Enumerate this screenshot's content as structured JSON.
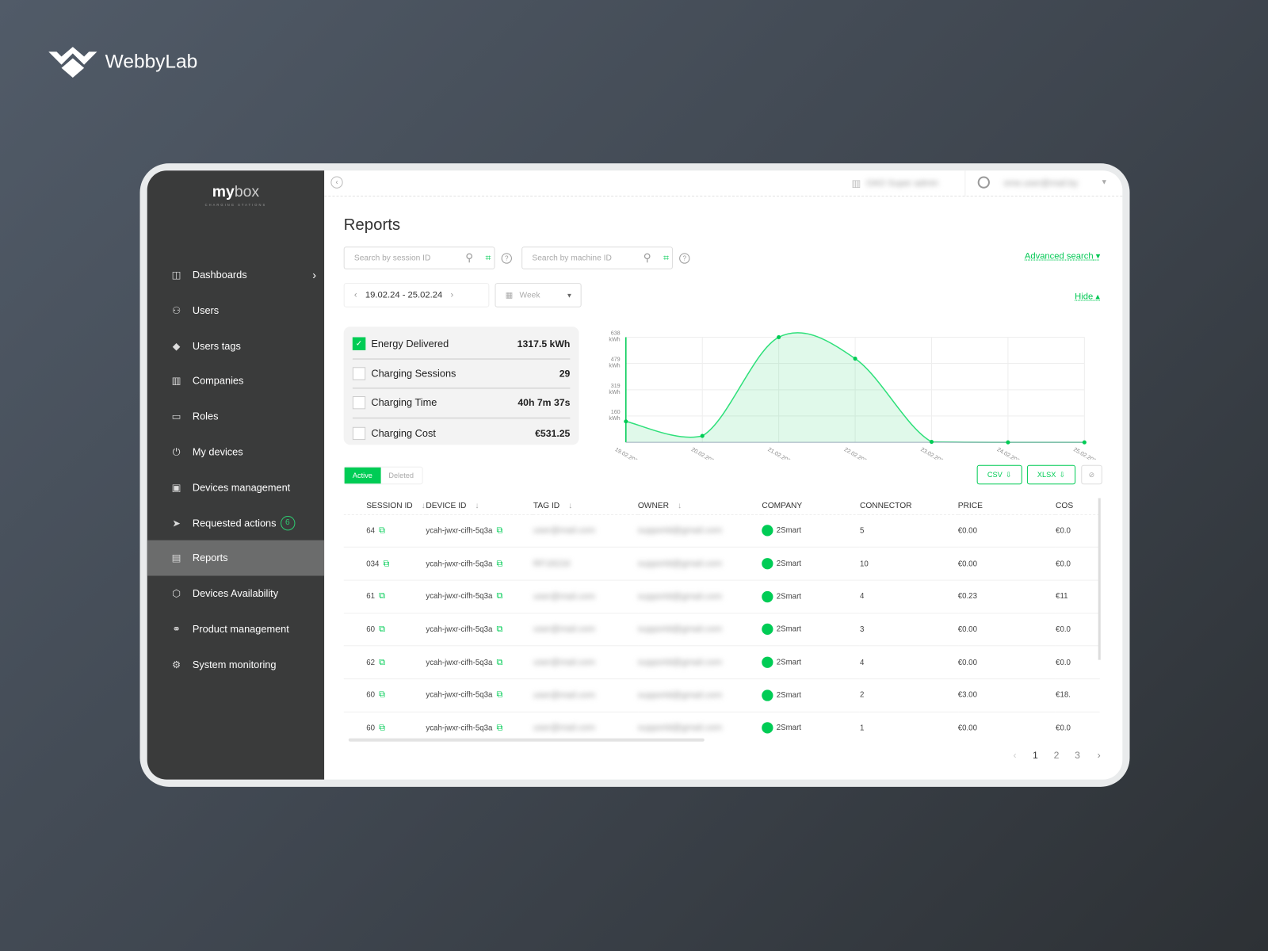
{
  "brand": {
    "name": "WebbyLab"
  },
  "app": {
    "logo_bold": "my",
    "logo_light": "box",
    "logo_tagline": "CHARGING STATIONS"
  },
  "sidebar": {
    "items": [
      {
        "label": "Dashboards",
        "icon": "dashboard-icon",
        "has_chevron": true
      },
      {
        "label": "Users",
        "icon": "users-icon"
      },
      {
        "label": "Users tags",
        "icon": "tag-icon"
      },
      {
        "label": "Companies",
        "icon": "building-icon"
      },
      {
        "label": "Roles",
        "icon": "id-card-icon"
      },
      {
        "label": "My devices",
        "icon": "plug-icon"
      },
      {
        "label": "Devices management",
        "icon": "device-folder-icon"
      },
      {
        "label": "Requested actions",
        "icon": "send-icon",
        "badge": "6"
      },
      {
        "label": "Reports",
        "icon": "document-icon",
        "active": true
      },
      {
        "label": "Devices Availability",
        "icon": "box-icon"
      },
      {
        "label": "Product management",
        "icon": "link-icon"
      },
      {
        "label": "System monitoring",
        "icon": "gear-icon"
      }
    ]
  },
  "topbar": {
    "company": "ОАО Super admin",
    "user": "ome.user@mail.by"
  },
  "page": {
    "title": "Reports"
  },
  "search": {
    "session_placeholder": "Search by session ID",
    "machine_placeholder": "Search by machine ID",
    "advanced": "Advanced search",
    "hide": "Hide"
  },
  "period": {
    "range": "19.02.24 - 25.02.24",
    "granularity": "Week"
  },
  "stats": [
    {
      "label": "Energy Delivered",
      "value": "1317.5 kWh",
      "checked": true
    },
    {
      "label": "Charging Sessions",
      "value": "29",
      "checked": false
    },
    {
      "label": "Charging Time",
      "value": "40h 7m 37s",
      "checked": false
    },
    {
      "label": "Charging Cost",
      "value": "€531.25",
      "checked": false
    }
  ],
  "chart_data": {
    "type": "area",
    "x": [
      "19.02.2024",
      "20.02.2024",
      "21.02.2024",
      "22.02.2024",
      "23.02.2024",
      "24.02.2024",
      "25.02.2024"
    ],
    "values": [
      127,
      39,
      638,
      508,
      3,
      0,
      0
    ],
    "yticks": [
      "160 kWh",
      "319 kWh",
      "479 kWh",
      "638 kWh"
    ],
    "ylim": [
      0,
      638
    ],
    "unit": "kWh",
    "grid": true,
    "color": "#00cc55"
  },
  "tabs": {
    "active": "Active",
    "deleted": "Deleted"
  },
  "export": {
    "csv": "CSV",
    "xlsx": "XLSX"
  },
  "table": {
    "columns": [
      "SESSION ID",
      "DEVICE ID",
      "TAG ID",
      "OWNER",
      "COMPANY",
      "CONNECTOR",
      "PRICE",
      "COS"
    ],
    "rows": [
      {
        "session": "64",
        "device": "ycah-jwxr-cifh-5q3a",
        "tag": "user@mail.com",
        "owner": "supportd@gmail.com",
        "company": "2Smart",
        "connector": "5",
        "price": "€0.00",
        "cost": "€0.0"
      },
      {
        "session": "034",
        "device": "ycah-jwxr-cifh-5q3a",
        "tag": "RF1822d",
        "owner": "supportd@gmail.com",
        "company": "2Smart",
        "connector": "10",
        "price": "€0.00",
        "cost": "€0.0"
      },
      {
        "session": "61",
        "device": "ycah-jwxr-cifh-5q3a",
        "tag": "user@mail.com",
        "owner": "supportd@gmail.com",
        "company": "2Smart",
        "connector": "4",
        "price": "€0.23",
        "cost": "€11"
      },
      {
        "session": "60",
        "device": "ycah-jwxr-cifh-5q3a",
        "tag": "user@mail.com",
        "owner": "supportd@gmail.com",
        "company": "2Smart",
        "connector": "3",
        "price": "€0.00",
        "cost": "€0.0"
      },
      {
        "session": "62",
        "device": "ycah-jwxr-cifh-5q3a",
        "tag": "user@mail.com",
        "owner": "supportd@gmail.com",
        "company": "2Smart",
        "connector": "4",
        "price": "€0.00",
        "cost": "€0.0"
      },
      {
        "session": "60",
        "device": "ycah-jwxr-cifh-5q3a",
        "tag": "user@mail.com",
        "owner": "supportd@gmail.com",
        "company": "2Smart",
        "connector": "2",
        "price": "€3.00",
        "cost": "€18."
      },
      {
        "session": "60",
        "device": "ycah-jwxr-cifh-5q3a",
        "tag": "user@mail.com",
        "owner": "supportd@gmail.com",
        "company": "2Smart",
        "connector": "1",
        "price": "€0.00",
        "cost": "€0.0"
      }
    ]
  },
  "pagination": {
    "pages": [
      "1",
      "2",
      "3"
    ],
    "current": "1"
  },
  "colors": {
    "accent": "#00cc55",
    "sidebar": "#3a3b3b"
  }
}
